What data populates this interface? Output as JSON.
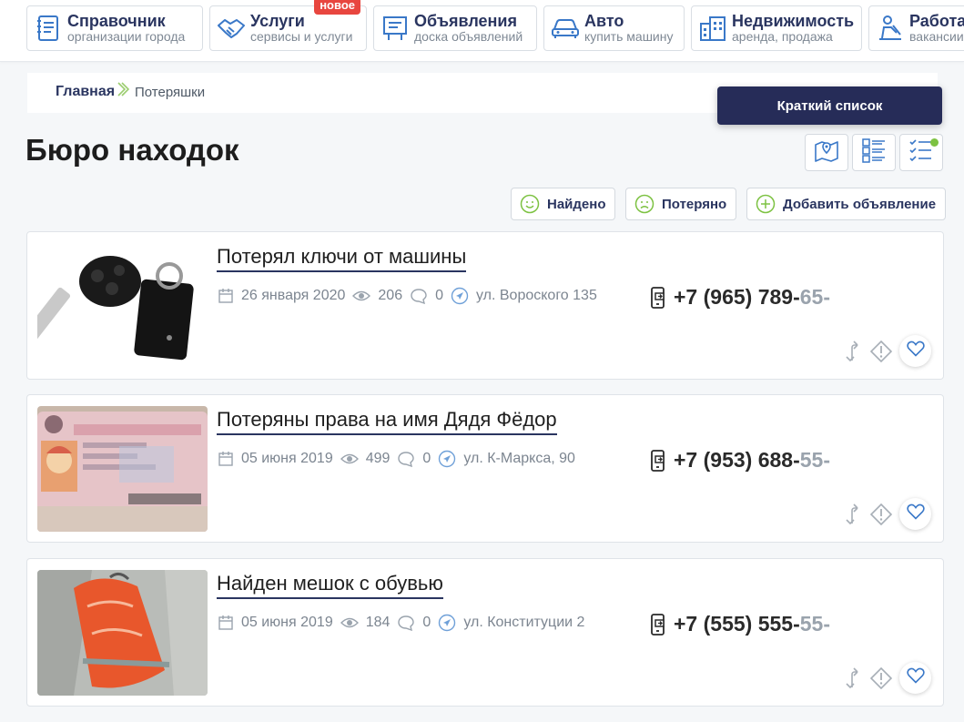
{
  "nav": {
    "items": [
      {
        "title": "Справочник",
        "sub": "организации города",
        "icon": "book-icon"
      },
      {
        "title": "Услуги",
        "sub": "сервисы и услуги",
        "icon": "handshake-icon",
        "badge": "новое"
      },
      {
        "title": "Объявления",
        "sub": "доска объявлений",
        "icon": "board-icon"
      },
      {
        "title": "Авто",
        "sub": "купить машину",
        "icon": "car-icon"
      },
      {
        "title": "Недвижимость",
        "sub": "аренда, продажа",
        "icon": "building-icon"
      },
      {
        "title": "Работа",
        "sub": "вакансии",
        "icon": "worker-icon"
      }
    ]
  },
  "breadcrumb": {
    "home": "Главная",
    "current": "Потеряшки"
  },
  "shortlist_label": "Краткий список",
  "page_title": "Бюро находок",
  "filters": {
    "found": "Найдено",
    "lost": "Потеряно",
    "add": "Добавить объявление"
  },
  "colors": {
    "brand": "#2a3560",
    "accent": "#7dc242",
    "badge": "#e8463f",
    "button": "#262c58"
  },
  "listings": [
    {
      "title": "Потерял ключи от машины",
      "date": "26 января 2020",
      "views": "206",
      "comments": "0",
      "address": "ул. Вороского 135",
      "phone_main": "+7 (965) 789-",
      "phone_masked": "65-",
      "image": "car-keys-photo"
    },
    {
      "title": "Потеряны права на имя Дядя Фёдор",
      "date": "05 июня 2019",
      "views": "499",
      "comments": "0",
      "address": "ул. К-Маркса, 90",
      "phone_main": "+7 (953) 688-",
      "phone_masked": "55-",
      "image": "driver-license-photo"
    },
    {
      "title": "Найден мешок с обувью",
      "date": "05 июня 2019",
      "views": "184",
      "comments": "0",
      "address": "ул. Конституции 2",
      "phone_main": "+7 (555) 555-",
      "phone_masked": "55-",
      "image": "orange-bag-photo"
    }
  ]
}
